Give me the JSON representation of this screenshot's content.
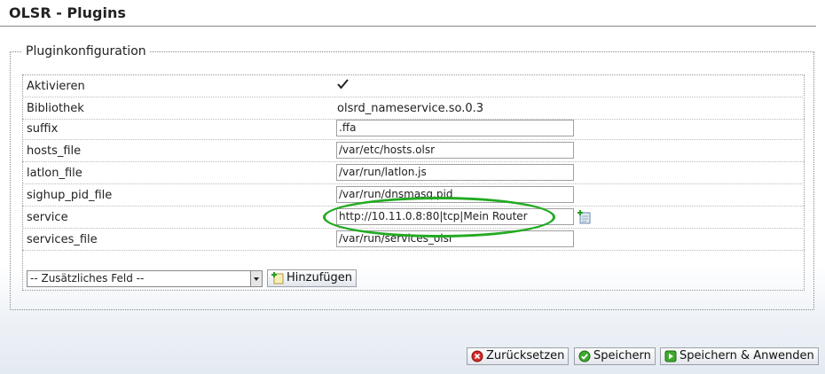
{
  "page": {
    "title": "OLSR - Plugins"
  },
  "config": {
    "legend": "Pluginkonfiguration",
    "rows": [
      {
        "label": "Aktivieren",
        "type": "checkbox",
        "checked": true
      },
      {
        "label": "Bibliothek",
        "type": "text",
        "value": "olsrd_nameservice.so.0.3"
      },
      {
        "label": "suffix",
        "type": "input",
        "value": ".ffa"
      },
      {
        "label": "hosts_file",
        "type": "input",
        "value": "/var/etc/hosts.olsr"
      },
      {
        "label": "latlon_file",
        "type": "input",
        "value": "/var/run/latlon.js"
      },
      {
        "label": "sighup_pid_file",
        "type": "input",
        "value": "/var/run/dnsmasq.pid"
      },
      {
        "label": "service",
        "type": "input",
        "value": "http://10.11.0.8:80|tcp|Mein Router"
      },
      {
        "label": "services_file",
        "type": "input",
        "value": "/var/run/services_olsr"
      }
    ],
    "add_field": {
      "select_value": "-- Zusätzliches Feld --",
      "button_label": "Hinzufügen"
    }
  },
  "actions": {
    "reset_label": "Zurücksetzen",
    "save_label": "Speichern",
    "save_apply_label": "Speichern & Anwenden"
  },
  "icons": {
    "checkbox": "check-icon",
    "add_field": "add-field-icon",
    "reset": "reset-icon",
    "save": "save-icon",
    "save_apply": "apply-icon"
  },
  "colors": {
    "highlight": "#22aa22",
    "reset_icon": "#cc2222",
    "save_icon": "#3a9a2a"
  }
}
